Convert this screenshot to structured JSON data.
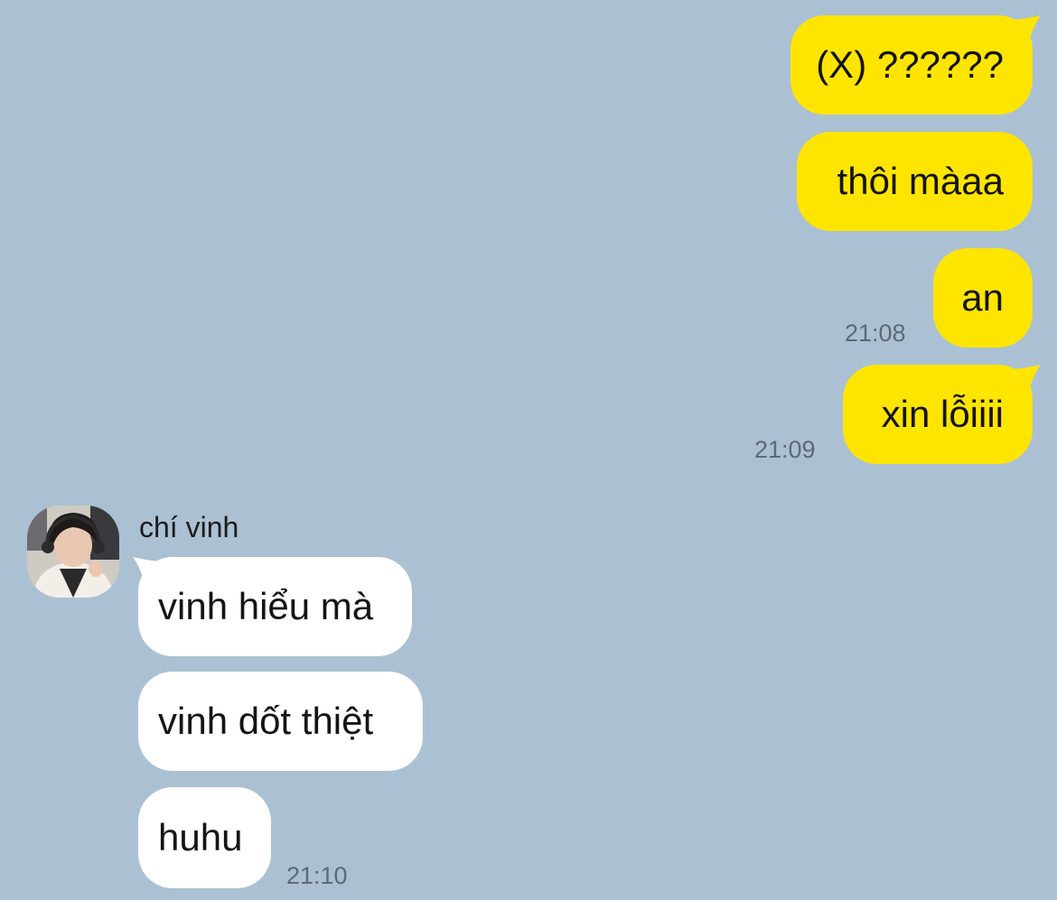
{
  "colors": {
    "background": "#abc1d3",
    "outgoing_bubble": "#fee500",
    "incoming_bubble": "#ffffff",
    "timestamp": "#5d6a75"
  },
  "outgoing": [
    {
      "text": "(X) ??????"
    },
    {
      "text": "thôi màaa"
    },
    {
      "text": "an",
      "time": "21:08"
    },
    {
      "text": "xin lỗiiii",
      "time": "21:09"
    }
  ],
  "incoming": {
    "sender": {
      "name": "chí vinh",
      "avatar": "profile-photo-icon"
    },
    "messages": [
      {
        "text": "vinh hiểu mà"
      },
      {
        "text": "vinh dốt thiệt"
      },
      {
        "text": "huhu",
        "time": "21:10"
      }
    ]
  }
}
